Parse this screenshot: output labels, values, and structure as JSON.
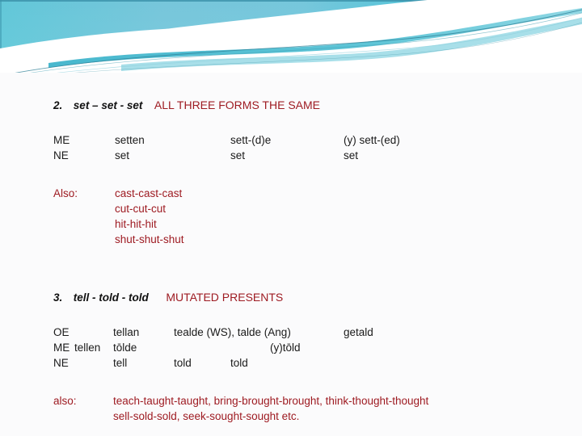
{
  "banner": {
    "name": "decorative-wave-banner",
    "colors": {
      "teal_light": "#7ecfe0",
      "teal_mid": "#5bc6d6",
      "teal_deep": "#36a9bd",
      "teal_edge": "#2f8ea4",
      "white": "#ffffff"
    }
  },
  "theme": {
    "background": "#fbfbfc",
    "text_color": "#1a1a1a",
    "accent_red": "#9e1b22"
  },
  "section_two": {
    "number": "2.",
    "forms": "set – set - set",
    "note": "ALL THREE FORMS THE SAME",
    "table": {
      "rows": [
        {
          "label": "ME",
          "c1": "setten",
          "c2": "sett-(d)e",
          "c3": "(y) sett-(ed)"
        },
        {
          "label": "NE",
          "c1": "set",
          "c2": "set",
          "c3": "set"
        }
      ]
    },
    "also": {
      "label": "Also:",
      "items": [
        "cast-cast-cast",
        "cut-cut-cut",
        "hit-hit-hit",
        "shut-shut-shut"
      ]
    }
  },
  "section_three": {
    "number": "3.",
    "forms": "tell  -  told  -  told",
    "note": "MUTATED PRESENTS",
    "table": {
      "rows": [
        {
          "label": "OE",
          "c1": "tellan",
          "c2": "tealde (WS), talde (Ang)",
          "c3": "getald"
        },
        {
          "label": "ME",
          "c1": "tellen",
          "c2": "tōlde",
          "c3": "",
          "c4": "(y)tōld"
        },
        {
          "label": "NE",
          "c1": "tell",
          "c2": "told",
          "c3": "told"
        }
      ]
    },
    "also": {
      "label": "also:",
      "lines": [
        "teach-taught-taught, bring-brought-brought, think-thought-thought",
        "sell-sold-sold, seek-sought-sought etc."
      ]
    }
  }
}
